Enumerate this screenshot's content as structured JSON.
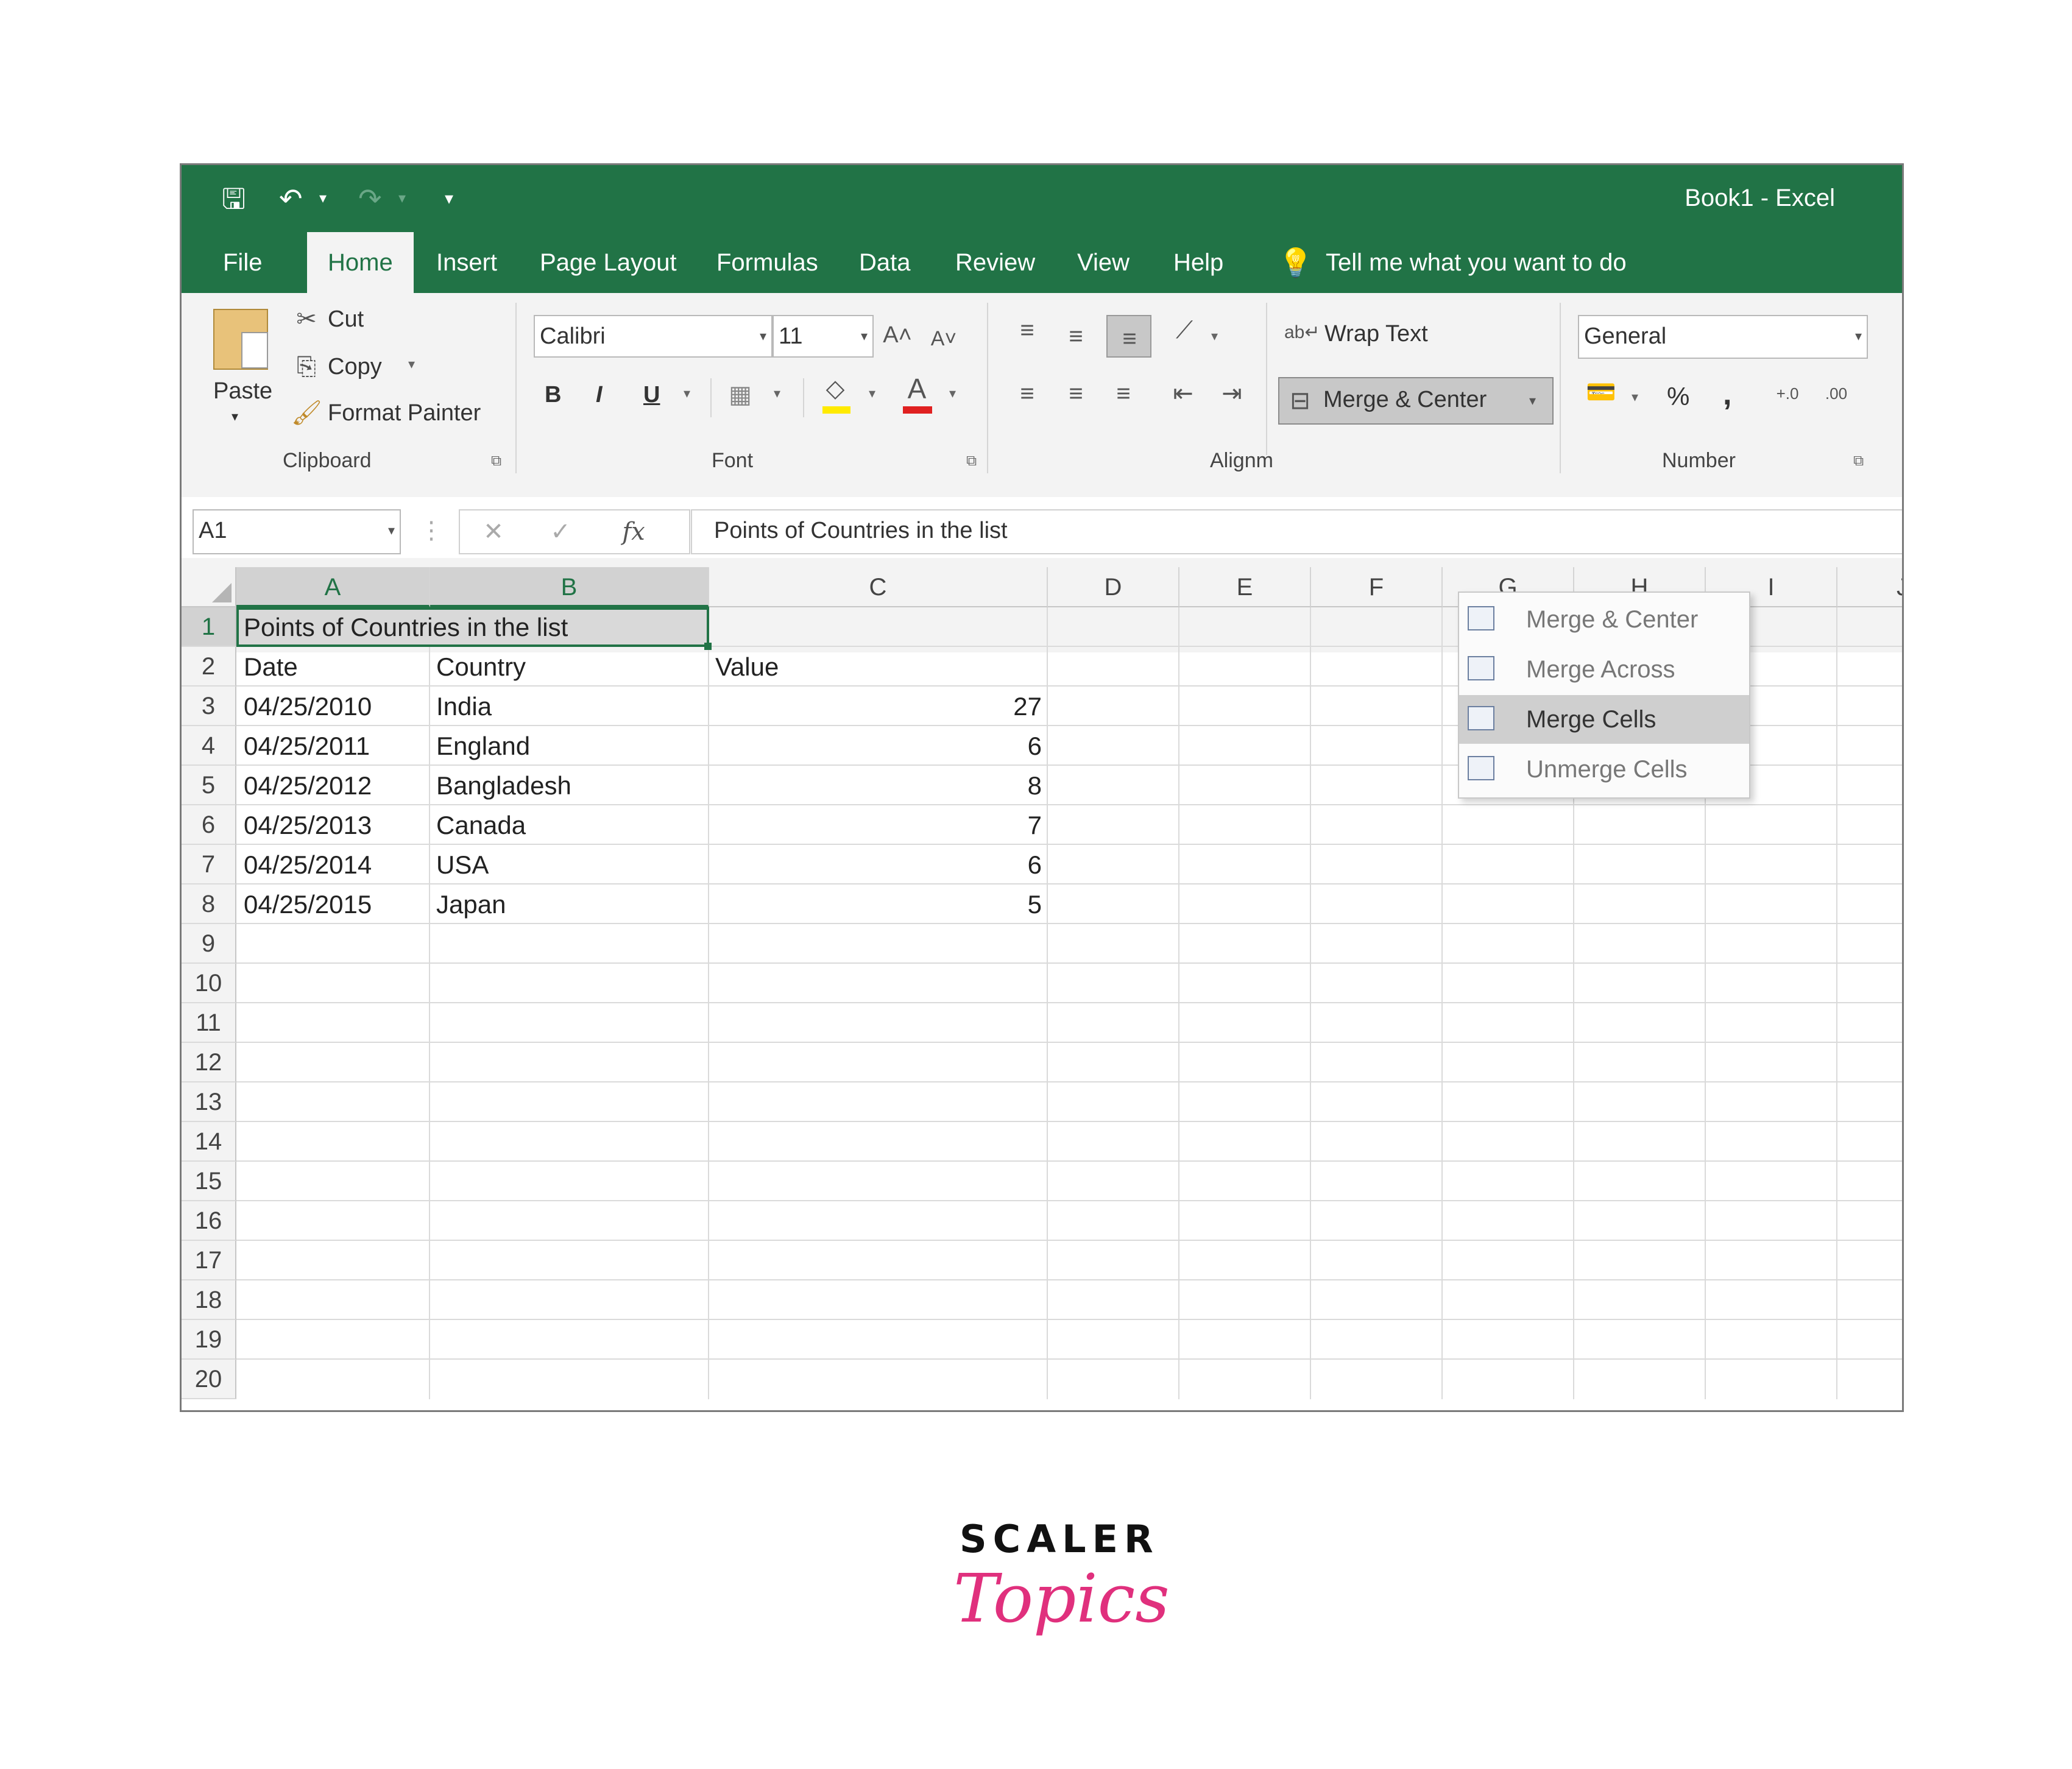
{
  "window": {
    "title": "Book1  -  Excel"
  },
  "quick_access": {
    "save": "🖫",
    "undo": "↶",
    "redo": "↷",
    "more": "▾"
  },
  "tabs": [
    "File",
    "Home",
    "Insert",
    "Page Layout",
    "Formulas",
    "Data",
    "Review",
    "View",
    "Help"
  ],
  "tell_me": "Tell me what you want to do",
  "clipboard": {
    "paste": "Paste",
    "cut": "Cut",
    "copy": "Copy",
    "format_painter": "Format Painter",
    "label": "Clipboard"
  },
  "font": {
    "name": "Calibri",
    "size": "11",
    "bold": "B",
    "italic": "I",
    "underline": "U",
    "label": "Font"
  },
  "alignment": {
    "wrap_text": "Wrap Text",
    "merge_center": "Merge & Center",
    "label": "Alignm"
  },
  "number": {
    "format": "General",
    "percent": "%",
    "comma": ",",
    "label": "Number"
  },
  "formula_bar": {
    "name_box": "A1",
    "fx": "fx",
    "content": "Points of Countries in the list"
  },
  "columns": [
    "A",
    "B",
    "C",
    "D",
    "E",
    "F",
    "G",
    "H",
    "I",
    "J"
  ],
  "rows": [
    "1",
    "2",
    "3",
    "4",
    "5",
    "6",
    "7",
    "8",
    "9",
    "10",
    "11",
    "12",
    "13",
    "14",
    "15",
    "16",
    "17",
    "18",
    "19",
    "20"
  ],
  "sheet": {
    "title": "Points of Countries in the list",
    "headers": [
      "Date",
      "Country",
      "Value"
    ],
    "data": [
      [
        "04/25/2010",
        "India",
        "27"
      ],
      [
        "04/25/2011",
        "England",
        "6"
      ],
      [
        "04/25/2012",
        "Bangladesh",
        "8"
      ],
      [
        "04/25/2013",
        "Canada",
        "7"
      ],
      [
        "04/25/2014",
        "USA",
        "6"
      ],
      [
        "04/25/2015",
        "Japan",
        "5"
      ]
    ]
  },
  "merge_menu": {
    "items": [
      "Merge & Center",
      "Merge Across",
      "Merge Cells",
      "Unmerge Cells"
    ],
    "highlighted": "Merge Cells"
  },
  "logo": {
    "line1": "SCALER",
    "line2": "Topics"
  },
  "colors": {
    "excel_green": "#217346",
    "brand_pink": "#e0307d"
  }
}
